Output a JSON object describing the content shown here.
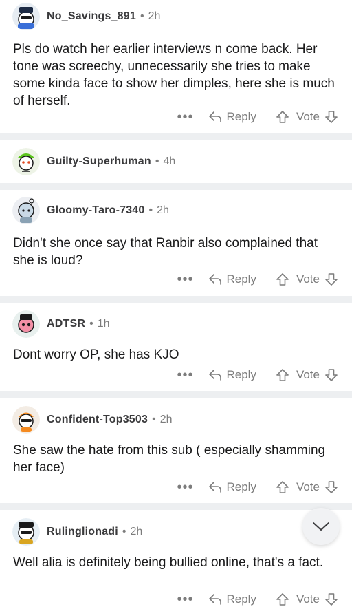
{
  "comments": [
    {
      "username": "No_Savings_891",
      "separator": "•",
      "time": "2h",
      "text": "Pls do watch her earlier interviews n come back. Her tone was screechy, unnecessarily she tries to make some kinda face to show her dimples, here she is much of herself.",
      "more": "•••",
      "reply": "Reply",
      "vote": "Vote"
    },
    {
      "username": "Guilty-Superhuman",
      "separator": "•",
      "time": "4h"
    },
    {
      "username": "Gloomy-Taro-7340",
      "separator": "•",
      "time": "2h",
      "text": "Didn't she once say that Ranbir also complained that she is loud?",
      "more": "•••",
      "reply": "Reply",
      "vote": "Vote"
    },
    {
      "username": "ADTSR",
      "separator": "•",
      "time": "1h",
      "text": "Dont worry OP, she has KJO",
      "more": "•••",
      "reply": "Reply",
      "vote": "Vote"
    },
    {
      "username": "Confident-Top3503",
      "separator": "•",
      "time": "2h",
      "text": "She saw the hate from this sub ( especially shamming her face)",
      "more": "•••",
      "reply": "Reply",
      "vote": "Vote"
    },
    {
      "username": "Rulinglionadi",
      "separator": "•",
      "time": "2h",
      "text": "Well alia is definitely being bullied online, that's a fact.",
      "more": "•••",
      "reply": "Reply",
      "vote": "Vote"
    }
  ],
  "icons": {
    "reply": "reply-arrow-icon",
    "upvote": "upvote-arrow-icon",
    "downvote": "downvote-arrow-icon",
    "scroll": "chevron-down-icon"
  },
  "colors": {
    "separator": "#edeff1",
    "muted": "#7c7c7c",
    "text": "#1a1a1b"
  }
}
